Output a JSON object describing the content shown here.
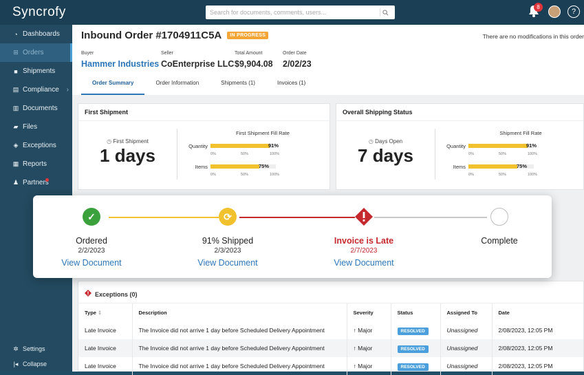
{
  "app": {
    "logo": "Syncrofy"
  },
  "search": {
    "placeholder": "Search for documents, comments, users..."
  },
  "topbar": {
    "notification_count": "8",
    "help": "?"
  },
  "sidebar": {
    "items": [
      {
        "label": "Dashboards",
        "icon": "speedometer-icon"
      },
      {
        "label": "Orders",
        "icon": "cart-icon"
      },
      {
        "label": "Shipments",
        "icon": "truck-icon"
      },
      {
        "label": "Compliance",
        "icon": "document-icon"
      },
      {
        "label": "Documents",
        "icon": "documents-icon"
      },
      {
        "label": "Files",
        "icon": "folder-icon"
      },
      {
        "label": "Exceptions",
        "icon": "exception-icon"
      },
      {
        "label": "Reports",
        "icon": "reports-icon"
      },
      {
        "label": "Partners",
        "icon": "partners-icon"
      }
    ],
    "settings": "Settings",
    "collapse": "Collapse"
  },
  "order": {
    "title": "Inbound Order #1704911C5A",
    "status": "IN PROGRESS",
    "modification_note": "There are no modifications in this order",
    "buyer_label": "Buyer",
    "buyer": "Hammer Industries",
    "seller_label": "Seller",
    "seller": "CoEnterprise LLC",
    "amount_label": "Total Amount",
    "amount": "$9,904.08",
    "date_label": "Order Date",
    "date": "2/02/23"
  },
  "tabs": [
    "Order Summary",
    "Order Information",
    "Shipments (1)",
    "Invoices (1)"
  ],
  "first_shipment": {
    "title": "First Shipment",
    "metric_label": "First Shipment",
    "metric_value": "1 days",
    "fill_title": "First Shipment Fill Rate",
    "quantity_label": "Quantity",
    "quantity_pct": 91,
    "quantity_text": "91%",
    "items_label": "Items",
    "items_pct": 75,
    "items_text": "75%",
    "ticks": [
      "0%",
      "50%",
      "100%"
    ]
  },
  "overall_status": {
    "title": "Overall Shipping Status",
    "metric_label": "Days Open",
    "metric_value": "7 days",
    "fill_title": "Shipment Fill Rate",
    "quantity_label": "Quantity",
    "quantity_pct": 91,
    "quantity_text": "91%",
    "items_label": "Items",
    "items_pct": 75,
    "items_text": "75%",
    "ticks": [
      "0%",
      "50%",
      "100%"
    ]
  },
  "timeline": [
    {
      "label": "Ordered",
      "date": "2/2/2023",
      "link": "View Document",
      "state": "done"
    },
    {
      "label": "91% Shipped",
      "date": "2/3/2023",
      "link": "View Document",
      "state": "progress"
    },
    {
      "label": "Invoice is Late",
      "date": "2/7/2023",
      "link": "View Document",
      "state": "late"
    },
    {
      "label": "Complete",
      "date": "",
      "link": "",
      "state": "pending"
    }
  ],
  "exceptions": {
    "title": "Exceptions (0)",
    "columns": [
      "Type",
      "Description",
      "Severity",
      "Status",
      "Assigned To",
      "Date"
    ],
    "rows": [
      {
        "type": "Late Invoice",
        "description": "The Invoice did not arrive 1 day before Scheduled Delivery Appointment",
        "severity": "Major",
        "status": "RESOLVED",
        "assigned": "Unassigned",
        "date": "2/08/2023, 12:05 PM"
      },
      {
        "type": "Late Invoice",
        "description": "The Invoice did not arrive 1 day before Scheduled Delivery Appointment",
        "severity": "Major",
        "status": "RESOLVED",
        "assigned": "Unassigned",
        "date": "2/08/2023, 12:05 PM"
      },
      {
        "type": "Late Invoice",
        "description": "The Invoice did not arrive 1 day before Scheduled Delivery Appointment",
        "severity": "Major",
        "status": "RESOLVED",
        "assigned": "Unassigned",
        "date": "2/08/2023, 12:05 PM"
      }
    ]
  },
  "colors": {
    "topbar": "#1b3f55",
    "sidebar": "#234a60",
    "accent": "#2d77b9",
    "status_pill": "#f3a536",
    "success": "#3aa13d",
    "progress": "#f2c12e",
    "late": "#c5282d",
    "bar": "#f2c12e"
  }
}
